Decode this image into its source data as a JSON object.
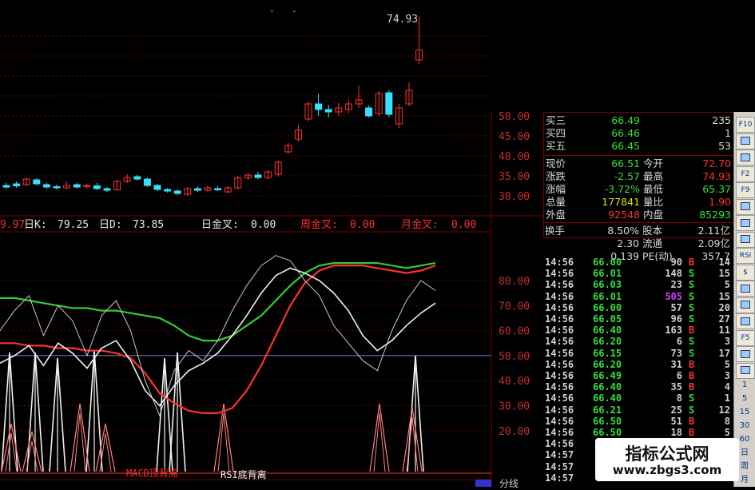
{
  "colors": {
    "up": "#ff3030",
    "down": "#33e0ff",
    "grid": "#7a0000",
    "green_text": "#33e033",
    "red_text": "#ff3030",
    "white": "#f0f0f0",
    "yellow": "#e0e000",
    "purple": "#cc44ff",
    "blue_line": "#7777cc"
  },
  "price_panel": {
    "last_label": "74.93",
    "axis_labels": [
      "50.00",
      "45.00",
      "40.00",
      "35.00",
      "30.00"
    ]
  },
  "indicator_strip": {
    "k_prev": "9.97",
    "k_label": "日K:",
    "k_value": "79.25",
    "d_label": "日D:",
    "d_value": "73.85",
    "day_cross_label": "日金叉:",
    "day_cross_value": "0.00",
    "week_cross_label": "周金叉:",
    "week_cross_value": "0.00",
    "month_cross_label": "月金叉:",
    "month_cross_value": "0.00"
  },
  "oscillator_panel": {
    "axis_labels": [
      "80.00",
      "70.00",
      "60.00",
      "50.00",
      "40.00",
      "30.00",
      "20.00"
    ],
    "label_macd": "MACD顶背离",
    "label_rsi": "RSI底背离"
  },
  "quote": {
    "buy_rows": [
      {
        "label": "买三",
        "price": "66.49",
        "vol": "235"
      },
      {
        "label": "买四",
        "price": "66.46",
        "vol": "1"
      },
      {
        "label": "买五",
        "price": "66.45",
        "vol": "53"
      }
    ],
    "stats": [
      {
        "l": "现价",
        "v": "66.51",
        "vc": "green",
        "r": "今开",
        "rv": "72.70",
        "rc": "red"
      },
      {
        "l": "涨跌",
        "v": "-2.57",
        "vc": "green",
        "r": "最高",
        "rv": "74.93",
        "rc": "red"
      },
      {
        "l": "涨幅",
        "v": "-3.72%",
        "vc": "green",
        "r": "最低",
        "rv": "65.37",
        "rc": "green"
      },
      {
        "l": "总量",
        "v": "177841",
        "vc": "yellow",
        "r": "量比",
        "rv": "1.90",
        "rc": "red"
      },
      {
        "l": "外盘",
        "v": "92548",
        "vc": "red",
        "r": "内盘",
        "rv": "85293",
        "rc": "green"
      }
    ],
    "extra": [
      {
        "l": "换手",
        "v": "8.50%",
        "r": "股本",
        "rv": "2.11亿"
      },
      {
        "l": "",
        "v": "2.30",
        "r": "流通",
        "rv": "2.09亿"
      },
      {
        "l": "",
        "v": "0.139",
        "r": "PE(动)",
        "rv": "357.7"
      }
    ]
  },
  "ticks": [
    {
      "t": "14:56",
      "p": "66.00",
      "v": "90",
      "f": "B",
      "n": "14"
    },
    {
      "t": "14:56",
      "p": "66.01",
      "v": "148",
      "f": "S",
      "n": "15"
    },
    {
      "t": "14:56",
      "p": "66.03",
      "v": "23",
      "f": "S",
      "n": "5"
    },
    {
      "t": "14:56",
      "p": "66.01",
      "v": "505",
      "f": "S",
      "n": "15"
    },
    {
      "t": "14:56",
      "p": "66.00",
      "v": "57",
      "f": "S",
      "n": "20"
    },
    {
      "t": "14:56",
      "p": "66.05",
      "v": "96",
      "f": "S",
      "n": "27"
    },
    {
      "t": "14:56",
      "p": "66.40",
      "v": "163",
      "f": "B",
      "n": "11"
    },
    {
      "t": "14:56",
      "p": "66.20",
      "v": "6",
      "f": "S",
      "n": "3"
    },
    {
      "t": "14:56",
      "p": "66.15",
      "v": "73",
      "f": "S",
      "n": "17"
    },
    {
      "t": "14:56",
      "p": "66.20",
      "v": "31",
      "f": "B",
      "n": "5"
    },
    {
      "t": "14:56",
      "p": "66.49",
      "v": "6",
      "f": "B",
      "n": "3"
    },
    {
      "t": "14:56",
      "p": "66.40",
      "v": "35",
      "f": "B",
      "n": "4"
    },
    {
      "t": "14:56",
      "p": "66.40",
      "v": "8",
      "f": "S",
      "n": "1"
    },
    {
      "t": "14:56",
      "p": "66.21",
      "v": "25",
      "f": "S",
      "n": "12"
    },
    {
      "t": "14:56",
      "p": "66.50",
      "v": "51",
      "f": "B",
      "n": "8"
    },
    {
      "t": "14:56",
      "p": "66.50",
      "v": "18",
      "f": "B",
      "n": "5"
    },
    {
      "t": "14:56",
      "p": "",
      "v": "",
      "f": "",
      "n": ""
    },
    {
      "t": "14:57",
      "p": "",
      "v": "",
      "f": "",
      "n": ""
    },
    {
      "t": "14:57",
      "p": "",
      "v": "",
      "f": "",
      "n": ""
    },
    {
      "t": "14:57",
      "p": "",
      "v": "",
      "f": "",
      "n": ""
    }
  ],
  "toolbar": {
    "buttons": [
      "F10",
      "",
      "",
      "F2",
      "F9",
      "",
      "",
      "",
      "RSI",
      "$",
      "",
      "",
      "",
      "F5",
      "",
      ""
    ],
    "periods": [
      "1",
      "5",
      "15",
      "30",
      "60",
      "日",
      "周",
      "月"
    ]
  },
  "watermark": {
    "title": "指标公式网",
    "url": "www.zbgs3.com"
  },
  "footer": {
    "label": "分线"
  },
  "chart_data": [
    {
      "type": "candlestick",
      "title": "",
      "ylim": [
        28,
        75
      ],
      "yticks": [
        50,
        45,
        40,
        35,
        30
      ],
      "candles": [
        {
          "o": 32.6,
          "c": 32.2,
          "h": 33.2,
          "l": 31.8
        },
        {
          "o": 33.0,
          "c": 32.5,
          "h": 33.6,
          "l": 32.0
        },
        {
          "o": 32.8,
          "c": 34.2,
          "h": 34.6,
          "l": 32.5
        },
        {
          "o": 34.0,
          "c": 33.0,
          "h": 34.4,
          "l": 32.6
        },
        {
          "o": 32.8,
          "c": 32.2,
          "h": 33.2,
          "l": 31.8
        },
        {
          "o": 32.3,
          "c": 32.0,
          "h": 32.8,
          "l": 31.6
        },
        {
          "o": 32.0,
          "c": 32.6,
          "h": 33.6,
          "l": 31.7
        },
        {
          "o": 32.8,
          "c": 32.2,
          "h": 33.2,
          "l": 31.9
        },
        {
          "o": 32.4,
          "c": 32.6,
          "h": 33.0,
          "l": 31.8
        },
        {
          "o": 32.5,
          "c": 31.8,
          "h": 33.2,
          "l": 31.5
        },
        {
          "o": 31.8,
          "c": 31.4,
          "h": 32.2,
          "l": 31.0
        },
        {
          "o": 31.5,
          "c": 33.6,
          "h": 34.0,
          "l": 31.3
        },
        {
          "o": 33.6,
          "c": 34.6,
          "h": 35.4,
          "l": 33.2
        },
        {
          "o": 34.8,
          "c": 34.2,
          "h": 35.2,
          "l": 33.8
        },
        {
          "o": 34.2,
          "c": 32.6,
          "h": 34.6,
          "l": 32.2
        },
        {
          "o": 32.6,
          "c": 31.6,
          "h": 33.0,
          "l": 31.2
        },
        {
          "o": 31.6,
          "c": 31.2,
          "h": 32.0,
          "l": 30.8
        },
        {
          "o": 31.2,
          "c": 30.6,
          "h": 31.6,
          "l": 30.2
        },
        {
          "o": 30.4,
          "c": 31.8,
          "h": 32.2,
          "l": 30.0
        },
        {
          "o": 31.8,
          "c": 31.4,
          "h": 32.4,
          "l": 31.0
        },
        {
          "o": 31.4,
          "c": 32.0,
          "h": 32.6,
          "l": 31.0
        },
        {
          "o": 31.8,
          "c": 31.6,
          "h": 32.4,
          "l": 31.2
        },
        {
          "o": 31.0,
          "c": 32.0,
          "h": 32.4,
          "l": 30.6
        },
        {
          "o": 32.0,
          "c": 34.5,
          "h": 35.0,
          "l": 31.6
        },
        {
          "o": 34.5,
          "c": 35.2,
          "h": 35.8,
          "l": 34.0
        },
        {
          "o": 35.2,
          "c": 34.6,
          "h": 36.0,
          "l": 34.2
        },
        {
          "o": 34.6,
          "c": 36.0,
          "h": 36.4,
          "l": 34.2
        },
        {
          "o": 35.4,
          "c": 38.4,
          "h": 38.8,
          "l": 34.8
        },
        {
          "o": 41.0,
          "c": 42.6,
          "h": 43.2,
          "l": 40.6
        },
        {
          "o": 44.2,
          "c": 46.4,
          "h": 47.8,
          "l": 43.6
        },
        {
          "o": 49.2,
          "c": 53.0,
          "h": 53.6,
          "l": 48.6
        },
        {
          "o": 53.0,
          "c": 51.6,
          "h": 55.6,
          "l": 50.0
        },
        {
          "o": 51.6,
          "c": 51.0,
          "h": 52.8,
          "l": 49.6
        },
        {
          "o": 51.0,
          "c": 52.0,
          "h": 53.2,
          "l": 50.0
        },
        {
          "o": 51.6,
          "c": 53.0,
          "h": 54.0,
          "l": 50.6
        },
        {
          "o": 53.0,
          "c": 54.0,
          "h": 57.6,
          "l": 52.0
        },
        {
          "o": 52.0,
          "c": 50.0,
          "h": 52.6,
          "l": 49.6
        },
        {
          "o": 50.6,
          "c": 55.6,
          "h": 56.2,
          "l": 50.0
        },
        {
          "o": 55.8,
          "c": 50.4,
          "h": 56.4,
          "l": 49.6
        },
        {
          "o": 48.0,
          "c": 52.0,
          "h": 53.0,
          "l": 47.0
        },
        {
          "o": 53.0,
          "c": 56.4,
          "h": 58.4,
          "l": 52.4
        },
        {
          "o": 64.0,
          "c": 66.5,
          "h": 74.93,
          "l": 63.0
        }
      ]
    },
    {
      "type": "line",
      "title": "",
      "ylim": [
        15,
        85
      ],
      "yticks": [
        80,
        70,
        60,
        50,
        40,
        30,
        20
      ],
      "series": [
        {
          "color": "#33cc33",
          "values": [
            73,
            73,
            72,
            71,
            70,
            69,
            69,
            68,
            68,
            67,
            66,
            65,
            62,
            58,
            56,
            56,
            58,
            62,
            66,
            72,
            78,
            83,
            86,
            87,
            87,
            87,
            87,
            86,
            85,
            86,
            87
          ]
        },
        {
          "color": "#ff3030",
          "values": [
            55,
            55,
            54,
            54,
            53,
            53,
            52,
            52,
            51,
            49,
            43,
            35,
            31,
            28,
            27,
            27,
            29,
            36,
            46,
            58,
            70,
            79,
            84,
            86,
            86,
            86,
            85,
            84,
            83,
            84,
            86
          ]
        },
        {
          "color": "#f0f0f0",
          "values": [
            47,
            50,
            54,
            46,
            55,
            51,
            45,
            53,
            56,
            48,
            36,
            30,
            38,
            44,
            47,
            51,
            58,
            66,
            75,
            82,
            85,
            83,
            80,
            75,
            68,
            58,
            52,
            56,
            62,
            67,
            71
          ]
        }
      ],
      "ref_line": 50,
      "annotations": [
        "MACD顶背离",
        "RSI底背离"
      ]
    }
  ]
}
